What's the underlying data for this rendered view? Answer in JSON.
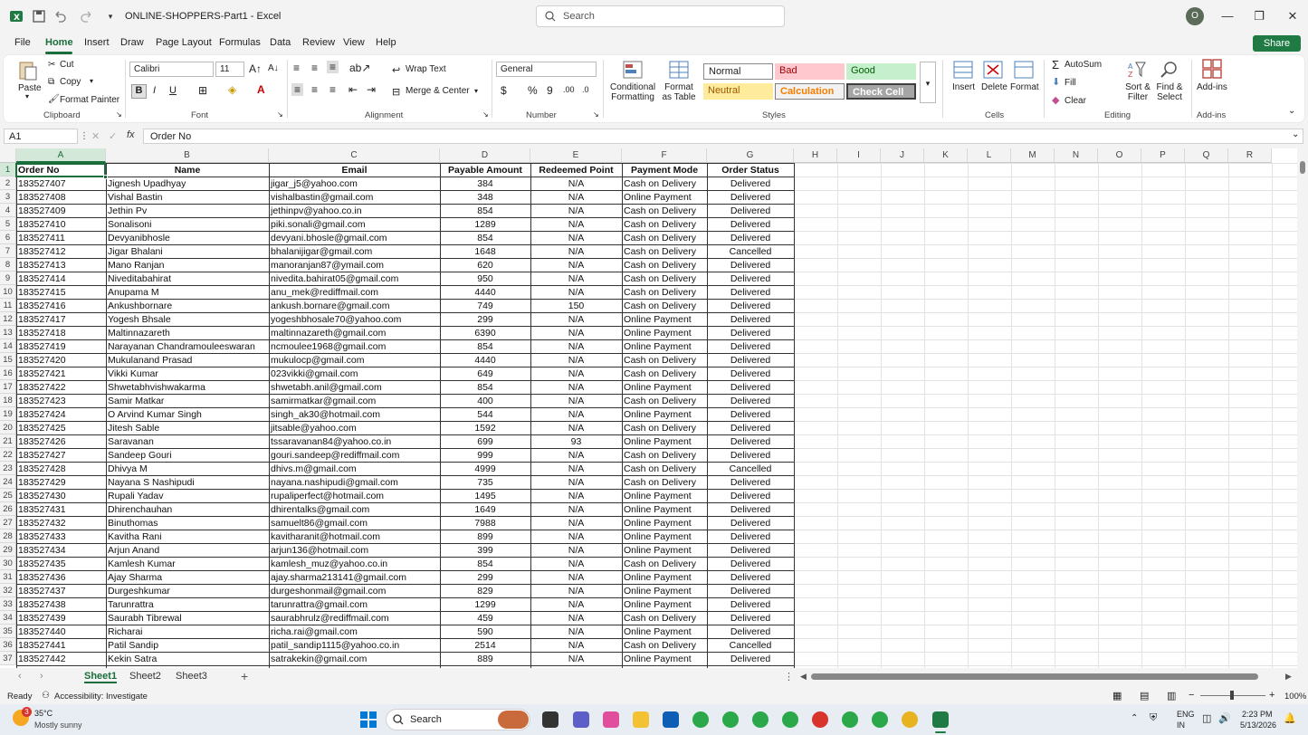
{
  "window": {
    "title": "ONLINE-SHOPPERS-Part1  -  Excel",
    "search_placeholder": "Search",
    "avatar": "O"
  },
  "menu": {
    "tabs": [
      "File",
      "Home",
      "Insert",
      "Draw",
      "Page Layout",
      "Formulas",
      "Data",
      "Review",
      "View",
      "Help"
    ],
    "active": "Home",
    "share": "Share"
  },
  "ribbon": {
    "clipboard": {
      "paste": "Paste",
      "cut": "Cut",
      "copy": "Copy",
      "format_painter": "Format Painter",
      "group": "Clipboard"
    },
    "font": {
      "name": "Calibri",
      "size": "11",
      "group": "Font"
    },
    "alignment": {
      "wrap": "Wrap Text",
      "merge": "Merge & Center",
      "group": "Alignment"
    },
    "number": {
      "format": "General",
      "group": "Number"
    },
    "styles": {
      "conditional": "Conditional Formatting",
      "format_table": "Format as Table",
      "normal": "Normal",
      "bad": "Bad",
      "good": "Good",
      "neutral": "Neutral",
      "calculation": "Calculation",
      "check_cell": "Check Cell",
      "group": "Styles"
    },
    "cells": {
      "insert": "Insert",
      "delete": "Delete",
      "format": "Format",
      "group": "Cells"
    },
    "editing": {
      "autosum": "AutoSum",
      "fill": "Fill",
      "clear": "Clear",
      "sort": "Sort & Filter",
      "find": "Find & Select",
      "group": "Editing"
    },
    "addins": {
      "label": "Add-ins",
      "group": "Add-ins"
    }
  },
  "formula_bar": {
    "name_box": "A1",
    "fx": "fx",
    "content": "Order No"
  },
  "columns": [
    "A",
    "B",
    "C",
    "D",
    "E",
    "F",
    "G",
    "H",
    "I",
    "J",
    "K",
    "L",
    "M",
    "N",
    "O",
    "P",
    "Q",
    "R"
  ],
  "table": {
    "headers": [
      "Order No",
      "Name",
      "Email",
      "Payable Amount",
      "Redeemed Point",
      "Payment Mode",
      "Order Status"
    ],
    "rows": [
      [
        "183527407",
        "Jignesh Upadhyay",
        "jigar_j5@yahoo.com",
        "384",
        "N/A",
        "Cash on Delivery",
        "Delivered"
      ],
      [
        "183527408",
        "Vishal Bastin",
        "vishalbastin@gmail.com",
        "348",
        "N/A",
        "Online Payment",
        "Delivered"
      ],
      [
        "183527409",
        "Jethin Pv",
        "jethinpv@yahoo.co.in",
        "854",
        "N/A",
        "Cash on Delivery",
        "Delivered"
      ],
      [
        "183527410",
        "Sonalisoni",
        "piki.sonali@gmail.com",
        "1289",
        "N/A",
        "Cash on Delivery",
        "Delivered"
      ],
      [
        "183527411",
        "Devyanibhosle",
        "devyani.bhosle@gmail.com",
        "854",
        "N/A",
        "Cash on Delivery",
        "Delivered"
      ],
      [
        "183527412",
        "Jigar Bhalani",
        "bhalanijigar@gmail.com",
        "1648",
        "N/A",
        "Cash on Delivery",
        "Cancelled"
      ],
      [
        "183527413",
        "Mano Ranjan",
        "manoranjan87@ymail.com",
        "620",
        "N/A",
        "Cash on Delivery",
        "Delivered"
      ],
      [
        "183527414",
        "Niveditabahirat",
        "nivedita.bahirat05@gmail.com",
        "950",
        "N/A",
        "Cash on Delivery",
        "Delivered"
      ],
      [
        "183527415",
        "Anupama M",
        "anu_mek@rediffmail.com",
        "4440",
        "N/A",
        "Cash on Delivery",
        "Delivered"
      ],
      [
        "183527416",
        "Ankushbornare",
        "ankush.bornare@gmail.com",
        "749",
        "150",
        "Cash on Delivery",
        "Delivered"
      ],
      [
        "183527417",
        "Yogesh Bhsale",
        "yogeshbhosale70@yahoo.com",
        "299",
        "N/A",
        "Online Payment",
        "Delivered"
      ],
      [
        "183527418",
        "Maltinnazareth",
        "maltinnazareth@gmail.com",
        "6390",
        "N/A",
        "Online Payment",
        "Delivered"
      ],
      [
        "183527419",
        "Narayanan Chandramouleeswaran",
        "ncmoulee1968@gmail.com",
        "854",
        "N/A",
        "Online Payment",
        "Delivered"
      ],
      [
        "183527420",
        "Mukulanand Prasad",
        "mukulocp@gmail.com",
        "4440",
        "N/A",
        "Cash on Delivery",
        "Delivered"
      ],
      [
        "183527421",
        "Vikki Kumar",
        "023vikki@gmail.com",
        "649",
        "N/A",
        "Cash on Delivery",
        "Delivered"
      ],
      [
        "183527422",
        "Shwetabhvishwakarma",
        "shwetabh.anil@gmail.com",
        "854",
        "N/A",
        "Online Payment",
        "Delivered"
      ],
      [
        "183527423",
        "Samir Matkar",
        "samirmatkar@gmail.com",
        "400",
        "N/A",
        "Cash on Delivery",
        "Delivered"
      ],
      [
        "183527424",
        "O Arvind Kumar Singh",
        "singh_ak30@hotmail.com",
        "544",
        "N/A",
        "Online Payment",
        "Delivered"
      ],
      [
        "183527425",
        "Jitesh Sable",
        "jitsable@yahoo.com",
        "1592",
        "N/A",
        "Cash on Delivery",
        "Delivered"
      ],
      [
        "183527426",
        "Saravanan",
        "tssaravanan84@yahoo.co.in",
        "699",
        "93",
        "Online Payment",
        "Delivered"
      ],
      [
        "183527427",
        "Sandeep Gouri",
        "gouri.sandeep@rediffmail.com",
        "999",
        "N/A",
        "Cash on Delivery",
        "Delivered"
      ],
      [
        "183527428",
        "Dhivya M",
        "dhivs.m@gmail.com",
        "4999",
        "N/A",
        "Cash on Delivery",
        "Cancelled"
      ],
      [
        "183527429",
        "Nayana S Nashipudi",
        "nayana.nashipudi@gmail.com",
        "735",
        "N/A",
        "Cash on Delivery",
        "Delivered"
      ],
      [
        "183527430",
        "Rupali Yadav",
        "rupaliperfect@hotmail.com",
        "1495",
        "N/A",
        "Online Payment",
        "Delivered"
      ],
      [
        "183527431",
        "Dhirenchauhan",
        "dhirentalks@gmail.com",
        "1649",
        "N/A",
        "Online Payment",
        "Delivered"
      ],
      [
        "183527432",
        "Binuthomas",
        "samuelt86@gmail.com",
        "7988",
        "N/A",
        "Online Payment",
        "Delivered"
      ],
      [
        "183527433",
        "Kavitha Rani",
        "kavitharanit@hotmail.com",
        "899",
        "N/A",
        "Online Payment",
        "Delivered"
      ],
      [
        "183527434",
        "Arjun Anand",
        "arjun136@hotmail.com",
        "399",
        "N/A",
        "Online Payment",
        "Delivered"
      ],
      [
        "183527435",
        "Kamlesh Kumar",
        "kamlesh_muz@yahoo.co.in",
        "854",
        "N/A",
        "Cash on Delivery",
        "Delivered"
      ],
      [
        "183527436",
        "Ajay Sharma",
        "ajay.sharma213141@gmail.com",
        "299",
        "N/A",
        "Online Payment",
        "Delivered"
      ],
      [
        "183527437",
        "Durgeshkumar",
        "durgeshonmail@gmail.com",
        "829",
        "N/A",
        "Online Payment",
        "Delivered"
      ],
      [
        "183527438",
        "Tarunrattra",
        "tarunrattra@gmail.com",
        "1299",
        "N/A",
        "Online Payment",
        "Delivered"
      ],
      [
        "183527439",
        "Saurabh Tibrewal",
        "saurabhrulz@rediffmail.com",
        "459",
        "N/A",
        "Cash on Delivery",
        "Delivered"
      ],
      [
        "183527440",
        "Richarai",
        "richa.rai@gmail.com",
        "590",
        "N/A",
        "Online Payment",
        "Delivered"
      ],
      [
        "183527441",
        "Patil Sandip",
        "patil_sandip1115@yahoo.co.in",
        "2514",
        "N/A",
        "Cash on Delivery",
        "Cancelled"
      ],
      [
        "183527442",
        "Kekin Satra",
        "satrakekin@gmail.com",
        "889",
        "N/A",
        "Online Payment",
        "Delivered"
      ]
    ]
  },
  "sheets": {
    "tabs": [
      "Sheet1",
      "Sheet2",
      "Sheet3"
    ],
    "active": "Sheet1"
  },
  "status": {
    "ready": "Ready",
    "accessibility": "Accessibility: Investigate",
    "zoom": "100%"
  },
  "taskbar": {
    "temp": "35°C",
    "weather": "Mostly sunny",
    "search": "Search",
    "lang1": "ENG",
    "lang2": "IN",
    "time": "2:23 PM",
    "date": "5/13/2026",
    "weather_badge": "3"
  },
  "colors": {
    "accent": "#1a6e3b",
    "bad_bg": "#ffc7ce",
    "good_bg": "#c6efce",
    "neutral_bg": "#ffeb9c"
  }
}
